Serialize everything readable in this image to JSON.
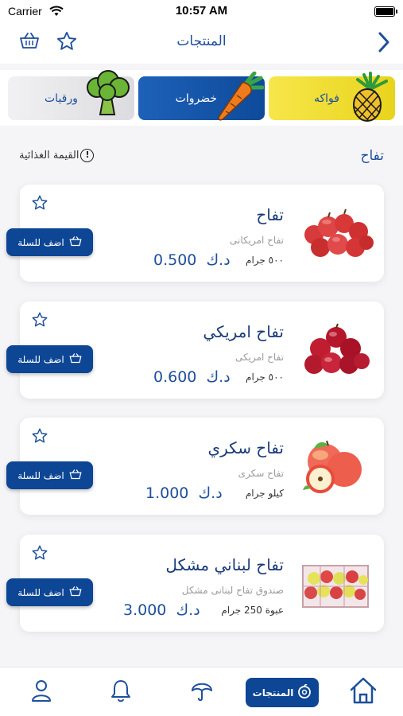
{
  "status_bar": {
    "carrier": "Carrier",
    "time": "10:57 AM"
  },
  "nav": {
    "title": "المنتجات"
  },
  "categories": [
    {
      "label": "فواكه"
    },
    {
      "label": "خضروات"
    },
    {
      "label": "ورقيات"
    }
  ],
  "section": {
    "title": "تفاح",
    "nutrition_label": "القيمة الغذائية"
  },
  "products": [
    {
      "name": "تفاح",
      "description": "تفاح امريكانى",
      "unit": "٥٠٠ جرام",
      "price": "0.500",
      "currency": "د.ك",
      "add_label": "اضف للسلة"
    },
    {
      "name": "تفاح امريكي",
      "description": "تفاح امريكى",
      "unit": "٥٠٠ جرام",
      "price": "0.600",
      "currency": "د.ك",
      "add_label": "اضف للسلة"
    },
    {
      "name": "تفاح سكري",
      "description": "تفاح سكرى",
      "unit": "كيلو جرام",
      "price": "1.000",
      "currency": "د.ك",
      "add_label": "اضف للسلة"
    },
    {
      "name": "تفاح لبناني مشكل",
      "description": "صندوق تفاح لبنانى مشكل",
      "unit": "عبوة 250 جرام",
      "price": "3.000",
      "currency": "د.ك",
      "add_label": "اضف للسلة"
    }
  ],
  "tabbar": {
    "products_label": "المنتجات"
  },
  "colors": {
    "primary": "#0d4694",
    "fruit_yellow": "#f1df36",
    "veg_blue": "#1d61b8",
    "leaf_gray": "#e7e7ea"
  }
}
